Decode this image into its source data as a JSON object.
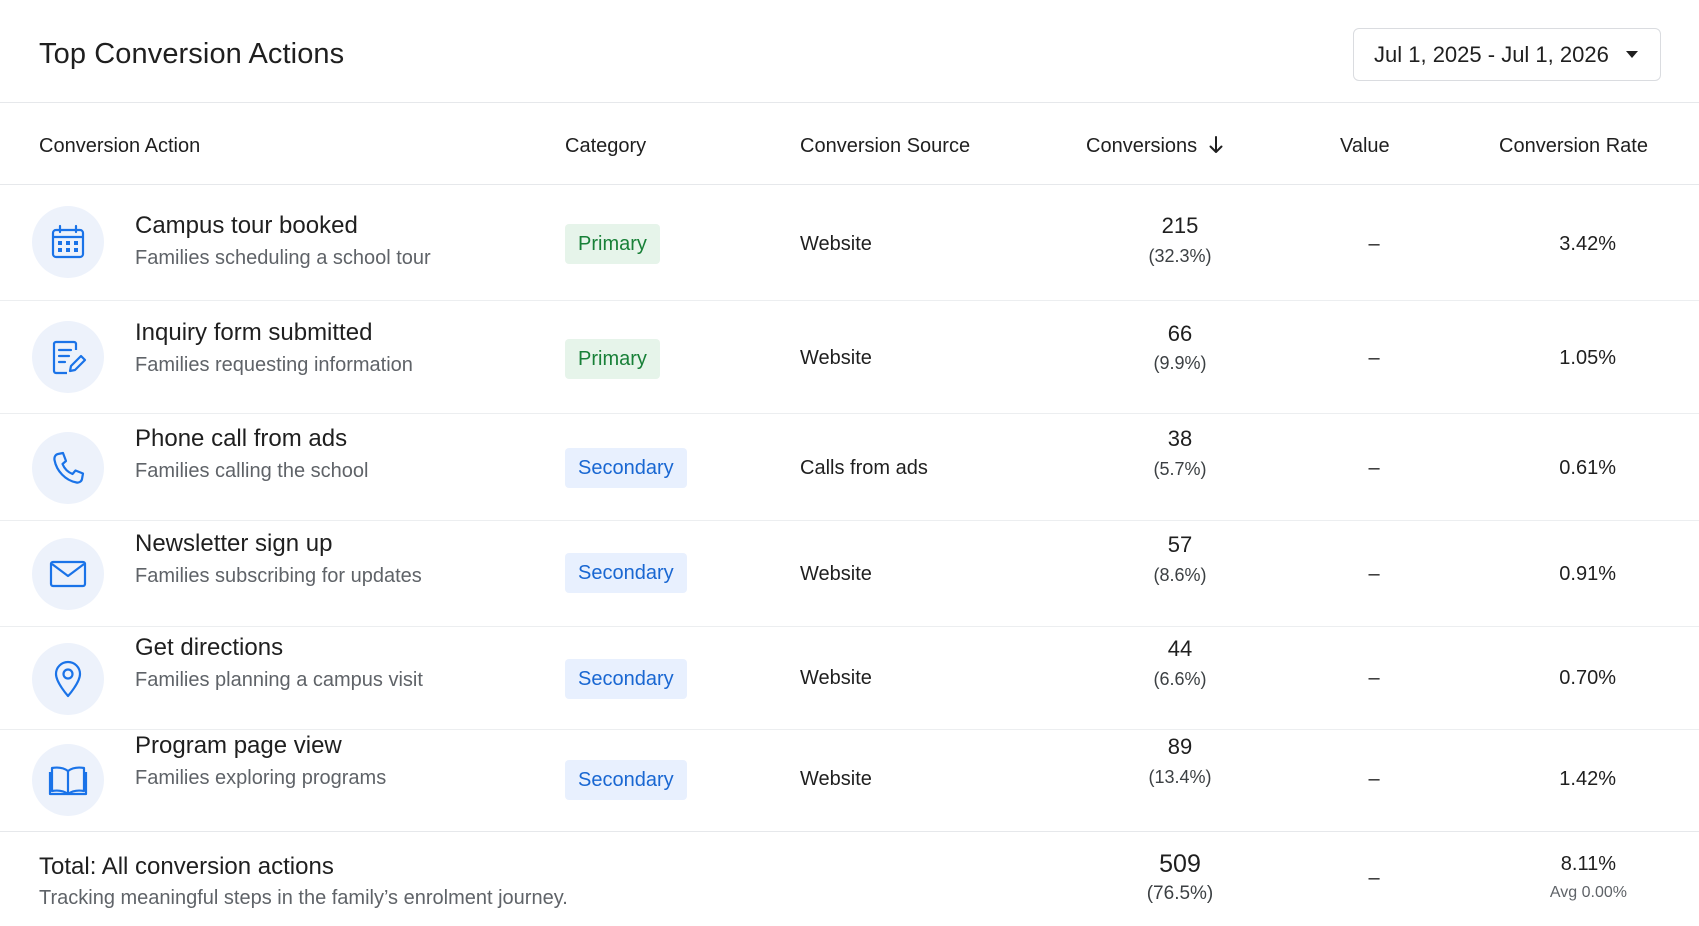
{
  "header": {
    "title": "Top Conversion Actions",
    "date_range": "Jul 1, 2025 - Jul 1, 2026"
  },
  "columns": {
    "action": "Conversion Action",
    "category": "Category",
    "source": "Conversion Source",
    "conversions": "Conversions",
    "value": "Value",
    "rate": "Conversion Rate"
  },
  "rows": [
    {
      "icon": "calendar-icon",
      "name": "Campus tour booked",
      "desc": "Families scheduling a school tour",
      "category": "Primary",
      "source": "Website",
      "conversions": "215",
      "pct": "(32.3%)",
      "value": "–",
      "rate": "3.42%"
    },
    {
      "icon": "form-edit-icon",
      "name": "Inquiry form submitted",
      "desc": "Families requesting information",
      "category": "Primary",
      "source": "Website",
      "conversions": "66",
      "pct": "(9.9%)",
      "value": "–",
      "rate": "1.05%"
    },
    {
      "icon": "phone-icon",
      "name": "Phone call from ads",
      "desc": "Families calling the school",
      "category": "Secondary",
      "source": "Calls from ads",
      "conversions": "38",
      "pct": "(5.7%)",
      "value": "–",
      "rate": "0.61%"
    },
    {
      "icon": "mail-icon",
      "name": "Newsletter sign up",
      "desc": "Families subscribing for updates",
      "category": "Secondary",
      "source": "Website",
      "conversions": "57",
      "pct": "(8.6%)",
      "value": "–",
      "rate": "0.91%"
    },
    {
      "icon": "location-pin-icon",
      "name": "Get directions",
      "desc": "Families planning a campus visit",
      "category": "Secondary",
      "source": "Website",
      "conversions": "44",
      "pct": "(6.6%)",
      "value": "–",
      "rate": "0.70%"
    },
    {
      "icon": "book-icon",
      "name": "Program page view",
      "desc": "Families exploring programs",
      "category": "Secondary",
      "source": "Website",
      "conversions": "89",
      "pct": "(13.4%)",
      "value": "–",
      "rate": "1.42%"
    }
  ],
  "total": {
    "title": "Total: All conversion actions",
    "subtitle": "Tracking meaningful steps in the family’s enrolment journey.",
    "conversions": "509",
    "pct": "(76.5%)",
    "value": "–",
    "rate": "8.11%",
    "avg": "Avg 0.00%"
  },
  "colors": {
    "primary_badge_bg": "#e6f4ea",
    "primary_badge_text": "#188038",
    "secondary_badge_bg": "#e8f0fe",
    "secondary_badge_text": "#1967d2",
    "icon_blue": "#1a73e8",
    "icon_bg": "#edf2fb"
  }
}
